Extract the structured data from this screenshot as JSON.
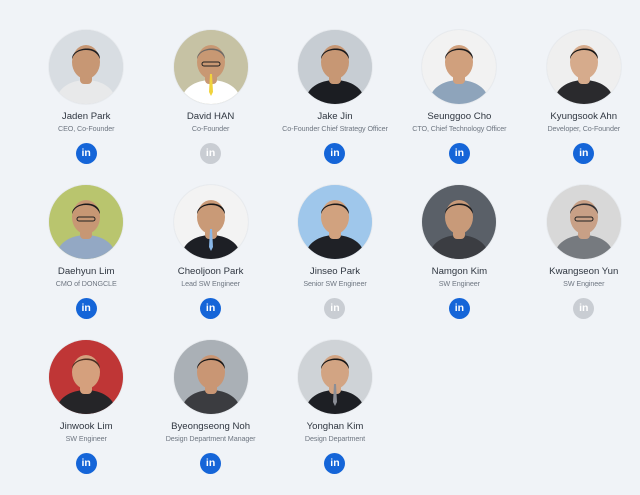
{
  "colors": {
    "page_background": "#f0f3f7",
    "linkedin_active": "#1565d8",
    "linkedin_inactive": "#c9cdd3"
  },
  "icons": {
    "linkedin_label": "in"
  },
  "team": [
    {
      "name": "Jaden Park",
      "title": "CEO, Co-Founder",
      "linkedin_active": true,
      "bg": "#d8dde2",
      "shirt": "#e8e9ea",
      "hair": "#1f1f22",
      "skin": "#c79774"
    },
    {
      "name": "David HAN",
      "title": "Co-Founder",
      "linkedin_active": false,
      "bg": "#c6c2a4",
      "shirt": "#ffffff",
      "hair": "#6f6a66",
      "skin": "#c89873"
    },
    {
      "name": "Jake Jin",
      "title": "Co-Founder Chief Strategy Officer",
      "linkedin_active": true,
      "bg": "#c7cdd3",
      "shirt": "#1b1d22",
      "hair": "#1a1a1c",
      "skin": "#c79774"
    },
    {
      "name": "Seunggoo Cho",
      "title": "CTO, Chief Technology Officer",
      "linkedin_active": true,
      "bg": "#f2f2f2",
      "shirt": "#8ea4bb",
      "hair": "#1c1c1e",
      "skin": "#d0a07d"
    },
    {
      "name": "Kyungsook Ahn",
      "title": "Developer, Co-Founder",
      "linkedin_active": true,
      "bg": "#efefef",
      "shirt": "#2a2a2d",
      "hair": "#151515",
      "skin": "#d6ab8c"
    },
    {
      "name": "Daehyun Lim",
      "title": "CMO of DONGCLE",
      "linkedin_active": true,
      "bg": "#b9c56e",
      "shirt": "#93a8c4",
      "hair": "#1b1b1d",
      "skin": "#c79774"
    },
    {
      "name": "Cheoljoon Park",
      "title": "Lead SW Engineer",
      "linkedin_active": true,
      "bg": "#f3f3f3",
      "shirt": "#1d1f25",
      "hair": "#161617",
      "skin": "#c99a77"
    },
    {
      "name": "Jinseo Park",
      "title": "Senior SW Engineer",
      "linkedin_active": false,
      "bg": "#9fc7eb",
      "shirt": "#1f2126",
      "hair": "#1a1a1c",
      "skin": "#d1a27f"
    },
    {
      "name": "Namgon Kim",
      "title": "SW Engineer",
      "linkedin_active": true,
      "bg": "#5a6068",
      "shirt": "#3b3d42",
      "hair": "#1c1c1e",
      "skin": "#c89a79"
    },
    {
      "name": "Kwangseon Yun",
      "title": "SW Engineer",
      "linkedin_active": false,
      "bg": "#d8d8d8",
      "shirt": "#767a7f",
      "hair": "#303034",
      "skin": "#c8a086"
    },
    {
      "name": "Jinwook Lim",
      "title": "SW Engineer",
      "linkedin_active": true,
      "bg": "#bf3636",
      "shirt": "#252528",
      "hair": "#4b3224",
      "skin": "#d5a07d"
    },
    {
      "name": "Byeongseong Noh",
      "title": "Design Department Manager",
      "linkedin_active": true,
      "bg": "#aab0b6",
      "shirt": "#3b3c40",
      "hair": "#181819",
      "skin": "#c99674"
    },
    {
      "name": "Yonghan Kim",
      "title": "Design Department",
      "linkedin_active": true,
      "bg": "#cfd3d7",
      "shirt": "#1d1f24",
      "hair": "#151516",
      "skin": "#d2a483"
    }
  ]
}
